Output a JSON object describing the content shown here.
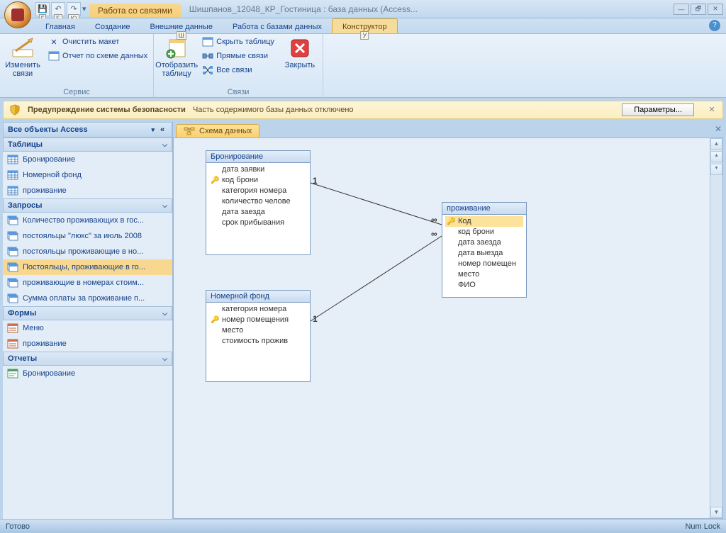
{
  "title": {
    "context_tab": "Работа со связями",
    "app_title": "Шишпанов_12048_КР_Гостиница : база данных (Access..."
  },
  "qat_keys": [
    "Г",
    "Б",
    "Ю"
  ],
  "ribbon_tabs": [
    {
      "label": "Главная",
      "key": ""
    },
    {
      "label": "Создание",
      "key": ""
    },
    {
      "label": "Внешние данные",
      "key": "Ш"
    },
    {
      "label": "Работа с базами данных",
      "key": ""
    },
    {
      "label": "Конструктор",
      "key": "У",
      "active": true
    }
  ],
  "ribbon": {
    "group1_label": "Сервис",
    "edit_rel": "Изменить связи",
    "clear_layout": "Очистить макет",
    "report_schema": "Отчет по схеме данных",
    "group2_label": "Связи",
    "show_table": "Отобразить таблицу",
    "hide_table": "Скрыть таблицу",
    "direct_rel": "Прямые связи",
    "all_rel": "Все связи",
    "close": "Закрыть"
  },
  "security": {
    "title": "Предупреждение системы безопасности",
    "msg": "Часть содержимого базы данных отключено",
    "btn": "Параметры..."
  },
  "nav": {
    "header": "Все объекты Access",
    "groups": [
      {
        "label": "Таблицы",
        "type": "table",
        "items": [
          "Бронирование",
          "Номерной фонд",
          "проживание"
        ]
      },
      {
        "label": "Запросы",
        "type": "query",
        "items": [
          "Количество проживающих в гос...",
          "постояльцы \"люкс\" за июль 2008",
          "постояльцы проживающие в но...",
          "Постояльцы, проживающие в го...",
          "проживающие в номерах стоим...",
          "Сумма оплаты за проживание п..."
        ]
      },
      {
        "label": "Формы",
        "type": "form",
        "items": [
          "Меню",
          "проживание"
        ]
      },
      {
        "label": "Отчеты",
        "type": "report",
        "items": [
          "Бронирование"
        ]
      }
    ],
    "selected": "Постояльцы, проживающие в го..."
  },
  "doc_tab": "Схема данных",
  "tables": {
    "t1": {
      "title": "Бронирование",
      "fields": [
        "дата заявки",
        "код брони",
        "категория номера",
        "количество челове",
        "дата заезда",
        "срок прибывания"
      ],
      "key_index": 1
    },
    "t2": {
      "title": "проживание",
      "fields": [
        "Код",
        "код брони",
        "дата заезда",
        "дата выезда",
        "номер помещен",
        "место",
        "ФИО"
      ],
      "key_index": 0,
      "sel_index": 0
    },
    "t3": {
      "title": "Номерной фонд",
      "fields": [
        "категория номера",
        "номер помещения",
        "место",
        "стоимость прожив"
      ],
      "key_index": 1
    }
  },
  "status": {
    "left": "Готово",
    "right": "Num Lock"
  }
}
